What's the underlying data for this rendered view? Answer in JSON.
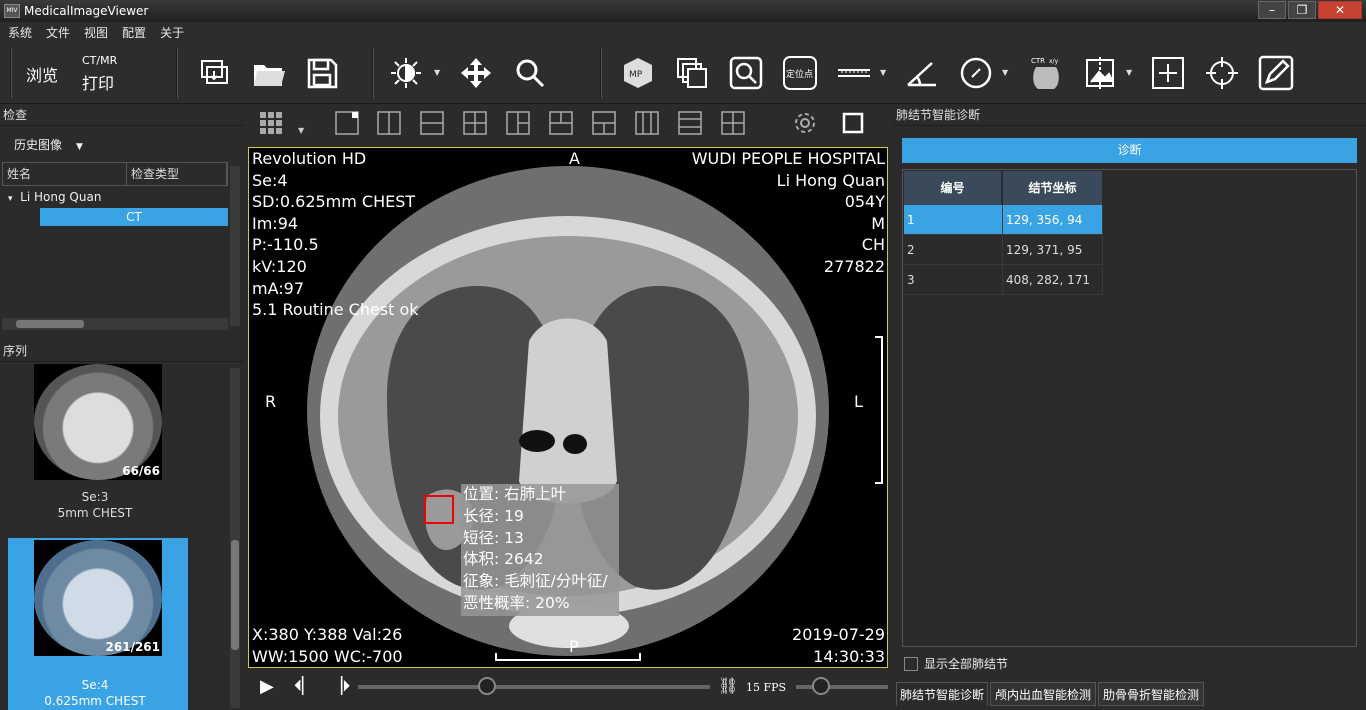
{
  "window": {
    "title": "MedicalImageViewer",
    "icon_text": "MIV"
  },
  "menu": [
    "系统",
    "文件",
    "视图",
    "配置",
    "关于"
  ],
  "toolbar": {
    "browse": "浏览",
    "ctmr": "CT/MR",
    "print": "打印",
    "locate": "定位点",
    "chest_label": "CTR",
    "chest_ratio": "x/y"
  },
  "check_panel": {
    "title": "检查",
    "history": "历史图像",
    "columns": [
      "姓名",
      "检查类型"
    ],
    "patient": "Li Hong Quan",
    "modality": "CT"
  },
  "series_panel": {
    "title": "序列",
    "items": [
      {
        "count": "66/66",
        "se": "Se:3",
        "desc": "5mm CHEST"
      },
      {
        "count": "261/261",
        "se": "Se:4",
        "desc": "0.625mm CHEST"
      }
    ]
  },
  "viewer": {
    "top_left": [
      "Revolution HD",
      "Se:4",
      "SD:0.625mm CHEST",
      "Im:94",
      "P:-110.5",
      "kV:120",
      "mA:97",
      "5.1 Routine Chest ok"
    ],
    "top_right": [
      "WUDI PEOPLE HOSPITAL",
      "Li Hong Quan",
      "054Y",
      "M",
      "CH",
      "277822"
    ],
    "orient": {
      "top": "A",
      "left": "R",
      "right": "L",
      "bottom": "P"
    },
    "bottom_left": [
      "X:380 Y:388 Val:26",
      "WW:1500 WC:-700"
    ],
    "bottom_right": [
      "2019-07-29",
      "14:30:33"
    ],
    "nodule_info": [
      "位置: 右肺上叶",
      "长径: 19",
      "短径: 13",
      "体积: 2642",
      "征象: 毛刺征/分叶征/",
      "恶性概率: 20%"
    ]
  },
  "playbar": {
    "fps": "15 FPS"
  },
  "right_panel": {
    "title": "肺结节智能诊断",
    "diagnose": "诊断",
    "columns": [
      "编号",
      "结节坐标"
    ],
    "rows": [
      {
        "id": "1",
        "coord": "129, 356, 94"
      },
      {
        "id": "2",
        "coord": "129, 371, 95"
      },
      {
        "id": "3",
        "coord": "408, 282, 171"
      }
    ],
    "show_all": "显示全部肺结节",
    "tabs": [
      "肺结节智能诊断",
      "颅内出血智能检测",
      "肋骨骨折智能检测"
    ]
  },
  "colors": {
    "accent": "#3aa3e3",
    "viewport_border": "#cfc84a",
    "nodule_box": "#e00000"
  }
}
